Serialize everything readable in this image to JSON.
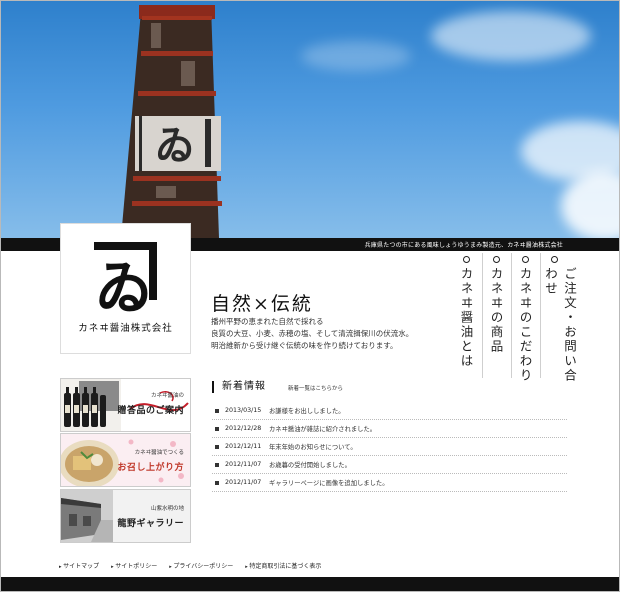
{
  "band_text": "兵庫県たつの市にある風味しょうゆうまみ製造元、カネヰ醤油株式会社",
  "logo": {
    "company": "カネヰ醤油株式会社"
  },
  "main": {
    "headline": "自然×伝統",
    "intro": [
      "播州平野の恵まれた自然で採れる",
      "良質の大豆、小麦、赤穂の塩、そして清流揖保川の伏流水。",
      "明治維新から受け継ぐ伝統の味を作り続けております。"
    ]
  },
  "nav": [
    {
      "label": "ご注文・お問い合わせ"
    },
    {
      "label": "カネヰのこだわり"
    },
    {
      "label": "カネヰの商品"
    },
    {
      "label": "カネヰ醤油とは"
    }
  ],
  "banners": [
    {
      "sub": "カネヰ醤油の",
      "title": "贈答品のご案内"
    },
    {
      "sub": "カネヰ醤油でつくる",
      "title": "お召し上がり方"
    },
    {
      "sub": "山紫水明の地",
      "title": "龍野ギャラリー"
    }
  ],
  "news": {
    "title": "新着情報",
    "link": "新着一覧はこちらから",
    "items": [
      {
        "date": "2013/03/15",
        "text": "お謙様をお出ししました。"
      },
      {
        "date": "2012/12/28",
        "text": "カネヰ醤油が雑誌に紹介されました。"
      },
      {
        "date": "2012/12/11",
        "text": "年末年始のお知らせについて。"
      },
      {
        "date": "2012/11/07",
        "text": "お歳暮の受付開始しました。"
      },
      {
        "date": "2012/11/07",
        "text": "ギャラリーページに画像を追加しました。"
      }
    ]
  },
  "footer": [
    "サイトマップ",
    "サイトポリシー",
    "プライバシーポリシー",
    "特定商取引法に基づく表示"
  ]
}
